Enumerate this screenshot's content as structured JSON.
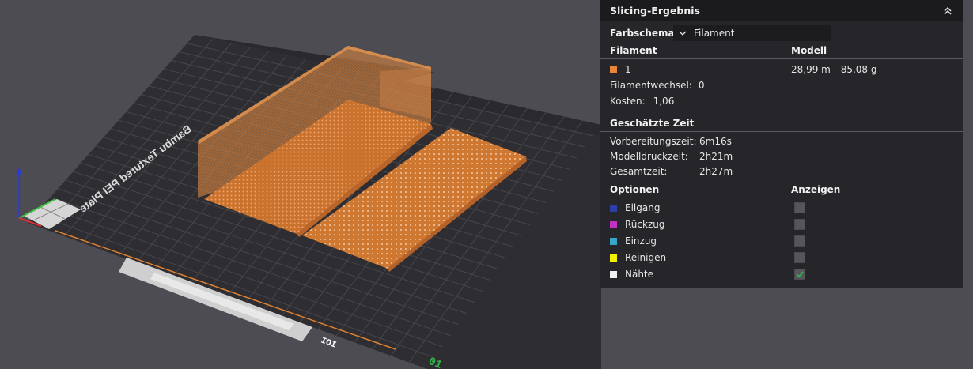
{
  "viewport": {
    "plate_label": "Bambu Textured PEI Plate",
    "plate_number": "01",
    "filament_color": "#e8873a",
    "axis_colors": {
      "x": "#d83030",
      "y": "#3fc040",
      "z": "#2a3ad8"
    }
  },
  "panel": {
    "title": "Slicing-Ergebnis",
    "collapse_icon": "chevron-double-up-icon",
    "color_scheme": {
      "label": "Farbschema",
      "selected": "Filament"
    },
    "filament_table": {
      "headers": [
        "Filament",
        "Modell"
      ],
      "rows": [
        {
          "swatch": "#e8873a",
          "id": "1",
          "length": "28,99 m",
          "weight": "85,08 g"
        }
      ]
    },
    "filament_changes": {
      "label": "Filamentwechsel:",
      "value": "0"
    },
    "cost": {
      "label": "Kosten:",
      "value": "1,06"
    },
    "time": {
      "heading": "Geschätzte Zeit",
      "rows": [
        {
          "label": "Vorbereitungszeit:",
          "value": "6m16s"
        },
        {
          "label": "Modelldruckzeit:",
          "value": "2h21m"
        },
        {
          "label": "Gesamtzeit:",
          "value": "2h27m"
        }
      ]
    },
    "options": {
      "headers": [
        "Optionen",
        "Anzeigen"
      ],
      "items": [
        {
          "label": "Eilgang",
          "color": "#2c3fa8",
          "checked": false
        },
        {
          "label": "Rückzug",
          "color": "#c430c4",
          "checked": false
        },
        {
          "label": "Einzug",
          "color": "#37a6c8",
          "checked": false
        },
        {
          "label": "Reinigen",
          "color": "#f0f000",
          "checked": false
        },
        {
          "label": "Nähte",
          "color": "#f0f0f0",
          "checked": true
        }
      ]
    }
  }
}
